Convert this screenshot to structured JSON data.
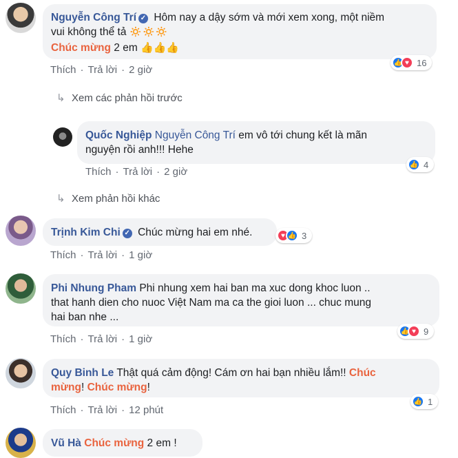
{
  "comments": [
    {
      "name": "Nguyễn Công Trí",
      "text1": "Hôm nay a dậy sớm và mới xem xong, một niềm",
      "text2": "vui không thể tả",
      "emoji1": "🔅🔅🔅",
      "highlight": "Chúc mừng",
      "text3": " 2 em",
      "emoji2": "👍👍👍",
      "like": "Thích",
      "reply": "Trả lời",
      "time": "2 giờ",
      "reactions": "16"
    },
    {
      "name": "Quốc Nghiệp",
      "tag": "Nguyễn Công Trí",
      "text1": " em vô tới chung kết là mãn",
      "text2": "nguyện rồi anh!!! Hehe",
      "like": "Thích",
      "reply": "Trả lời",
      "time": "2 giờ",
      "reactions": "4"
    },
    {
      "name": "Trịnh Kim Chi",
      "text1": "Chúc mừng hai em nhé.",
      "like": "Thích",
      "reply": "Trả lời",
      "time": "1 giờ",
      "reactions": "3"
    },
    {
      "name": "Phi Nhung Pham",
      "text1": "Phi nhung xem hai ban ma xuc dong khoc luon ..",
      "text2": "that hanh dien cho nuoc Việt Nam ma ca the gioi luon ... chuc mung",
      "text3": "hai ban nhe ...",
      "like": "Thích",
      "reply": "Trả lời",
      "time": "1 giờ",
      "reactions": "9"
    },
    {
      "name": "Quy Binh Le",
      "text1": "Thật quá cảm động! Cám ơn hai bạn nhiều lắm!! ",
      "hl1": "Chúc",
      "hl2": "mừng",
      "text2": "! ",
      "hl3": "Chúc mừng",
      "text3": "!",
      "like": "Thích",
      "reply": "Trả lời",
      "time": "12 phút",
      "reactions": "1"
    },
    {
      "name": "Vũ Hà",
      "highlight": "Chúc mừng",
      "text1": " 2 em !"
    }
  ],
  "links": {
    "previous_replies": "Xem các phản hồi trước",
    "other_replies": "Xem phản hồi khác"
  },
  "colors": {
    "name": "#385898",
    "highlight": "#e9633e",
    "like": "#1877f2",
    "love": "#f33e58"
  },
  "icons": {
    "verified": "verified-badge-icon",
    "reply_arrow": "reply-arrow-icon"
  }
}
